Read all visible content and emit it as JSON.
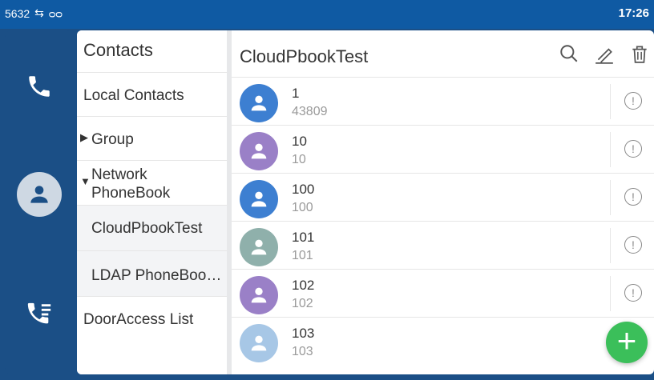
{
  "status": {
    "ext": "5632",
    "time": "17:26"
  },
  "sidebar": {
    "items": [
      {
        "icon": "phone-icon"
      },
      {
        "icon": "contacts-icon"
      },
      {
        "icon": "call-log-icon"
      }
    ]
  },
  "menu": {
    "title": "Contacts",
    "local": "Local Contacts",
    "group": "Group",
    "network": "Network\nPhoneBook",
    "cloud": "CloudPbookTest",
    "ldap": "LDAP PhoneBoo…",
    "door": "DoorAccess List"
  },
  "content": {
    "title": "CloudPbookTest",
    "contacts": [
      {
        "name": "1",
        "number": "43809",
        "color": "#3d7fd1"
      },
      {
        "name": "10",
        "number": "10",
        "color": "#9a80c7"
      },
      {
        "name": "100",
        "number": "100",
        "color": "#3d7fd1"
      },
      {
        "name": "101",
        "number": "101",
        "color": "#8fb0ab"
      },
      {
        "name": "102",
        "number": "102",
        "color": "#9a80c7"
      },
      {
        "name": "103",
        "number": "103",
        "color": "#a7c7e6"
      }
    ]
  }
}
